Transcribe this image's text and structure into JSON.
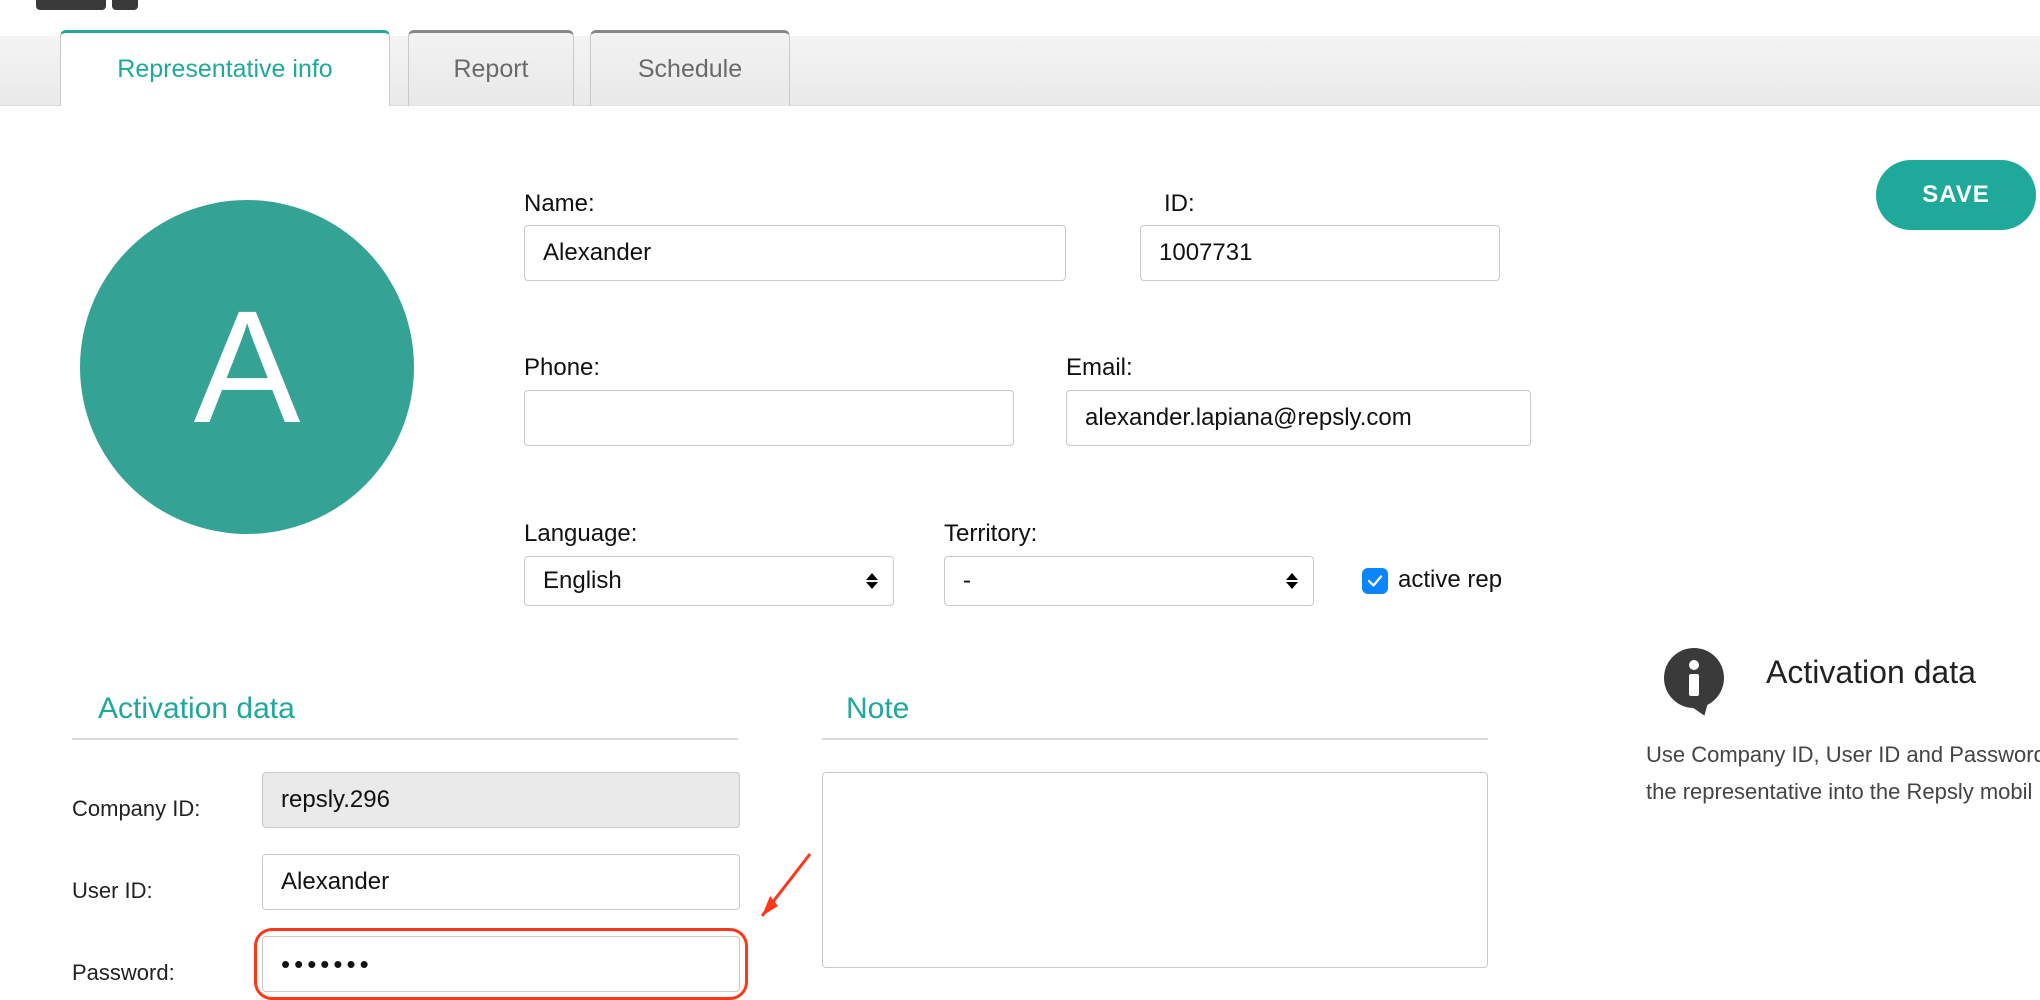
{
  "tabs": {
    "rep_info": "Representative info",
    "report": "Report",
    "schedule": "Schedule"
  },
  "avatar_letter": "A",
  "fields": {
    "name_label": "Name:",
    "name_value": "Alexander",
    "id_label": "ID:",
    "id_value": "1007731",
    "phone_label": "Phone:",
    "phone_value": "",
    "email_label": "Email:",
    "email_value": "alexander.lapiana@repsly.com",
    "language_label": "Language:",
    "language_value": "English",
    "territory_label": "Territory:",
    "territory_value": "-",
    "active_rep_label": "active rep"
  },
  "save_label": "SAVE",
  "activation": {
    "heading": "Activation data",
    "company_id_label": "Company ID:",
    "company_id_value": "repsly.296",
    "user_id_label": "User ID:",
    "user_id_value": "Alexander",
    "password_label": "Password:",
    "password_value": "•••••••"
  },
  "note_heading": "Note",
  "note_value": "",
  "info_title": "Activation data",
  "info_text": "Use Company ID, User ID and Password\nthe representative into the Repsly mobil"
}
